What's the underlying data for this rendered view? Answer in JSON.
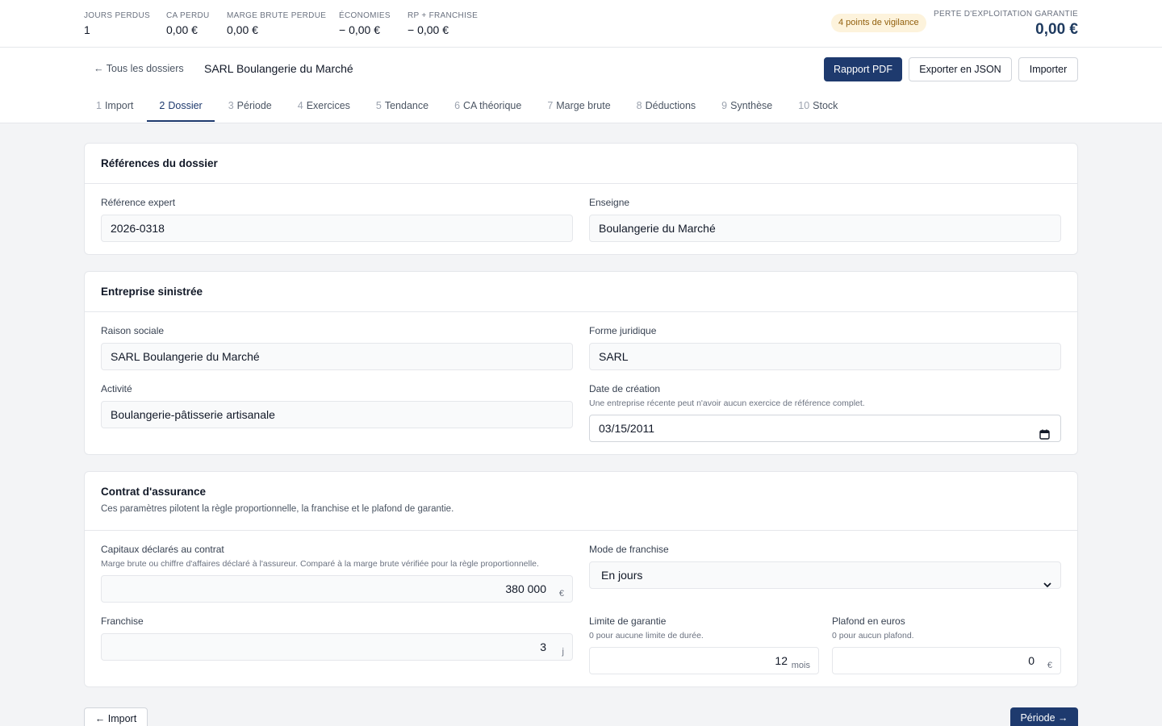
{
  "metrics": [
    {
      "label": "JOURS PERDUS",
      "value": "1"
    },
    {
      "label": "CA PERDU",
      "value": "0,00 €"
    },
    {
      "label": "MARGE BRUTE PERDUE",
      "value": "0,00 €"
    },
    {
      "label": "ÉCONOMIES",
      "value": "− 0,00 €"
    },
    {
      "label": "RP + FRANCHISE",
      "value": "− 0,00 €"
    }
  ],
  "vigilance": "4 points de vigilance",
  "perte": {
    "label": "PERTE D'EXPLOITATION GARANTIE",
    "value": "0,00 €"
  },
  "header": {
    "back_label": "← Tous les dossiers",
    "title": "SARL Boulangerie du Marché",
    "pdf_label": "Rapport PDF",
    "json_label": "Exporter en JSON",
    "import_label": "Importer"
  },
  "tabs": [
    {
      "num": "1",
      "label": "Import"
    },
    {
      "num": "2",
      "label": "Dossier"
    },
    {
      "num": "3",
      "label": "Période"
    },
    {
      "num": "4",
      "label": "Exercices"
    },
    {
      "num": "5",
      "label": "Tendance"
    },
    {
      "num": "6",
      "label": "CA théorique"
    },
    {
      "num": "7",
      "label": "Marge brute"
    },
    {
      "num": "8",
      "label": "Déductions"
    },
    {
      "num": "9",
      "label": "Synthèse"
    },
    {
      "num": "10",
      "label": "Stock"
    }
  ],
  "refs": {
    "title": "Références du dossier",
    "ref_label": "Référence expert",
    "ref_value": "2026-0318",
    "enseigne_label": "Enseigne",
    "enseigne_value": "Boulangerie du Marché"
  },
  "entreprise": {
    "title": "Entreprise sinistrée",
    "raison_label": "Raison sociale",
    "raison_value": "SARL Boulangerie du Marché",
    "forme_label": "Forme juridique",
    "forme_value": "SARL",
    "activite_label": "Activité",
    "activite_value": "Boulangerie-pâtisserie artisanale",
    "date_label": "Date de création",
    "date_help": "Une entreprise récente peut n'avoir aucun exercice de référence complet.",
    "date_value": "03/15/2011"
  },
  "contrat": {
    "title": "Contrat d'assurance",
    "desc": "Ces paramètres pilotent la règle proportionnelle, la franchise et le plafond de garantie.",
    "capitaux_label": "Capitaux déclarés au contrat",
    "capitaux_help": "Marge brute ou chiffre d'affaires déclaré à l'assureur. Comparé à la marge brute vérifiée pour la règle proportionnelle.",
    "capitaux_value": "380 000",
    "capitaux_unit": "€",
    "mode_label": "Mode de franchise",
    "mode_value": "En jours",
    "franchise_label": "Franchise",
    "franchise_value": "3",
    "franchise_unit": "j",
    "limite_label": "Limite de garantie",
    "limite_help": "0 pour aucune limite de durée.",
    "limite_value": "12",
    "limite_unit": "mois",
    "plafond_label": "Plafond en euros",
    "plafond_help": "0 pour aucun plafond.",
    "plafond_value": "0",
    "plafond_unit": "€"
  },
  "footer": {
    "prev_label": "← Import",
    "next_label": "Période →"
  }
}
